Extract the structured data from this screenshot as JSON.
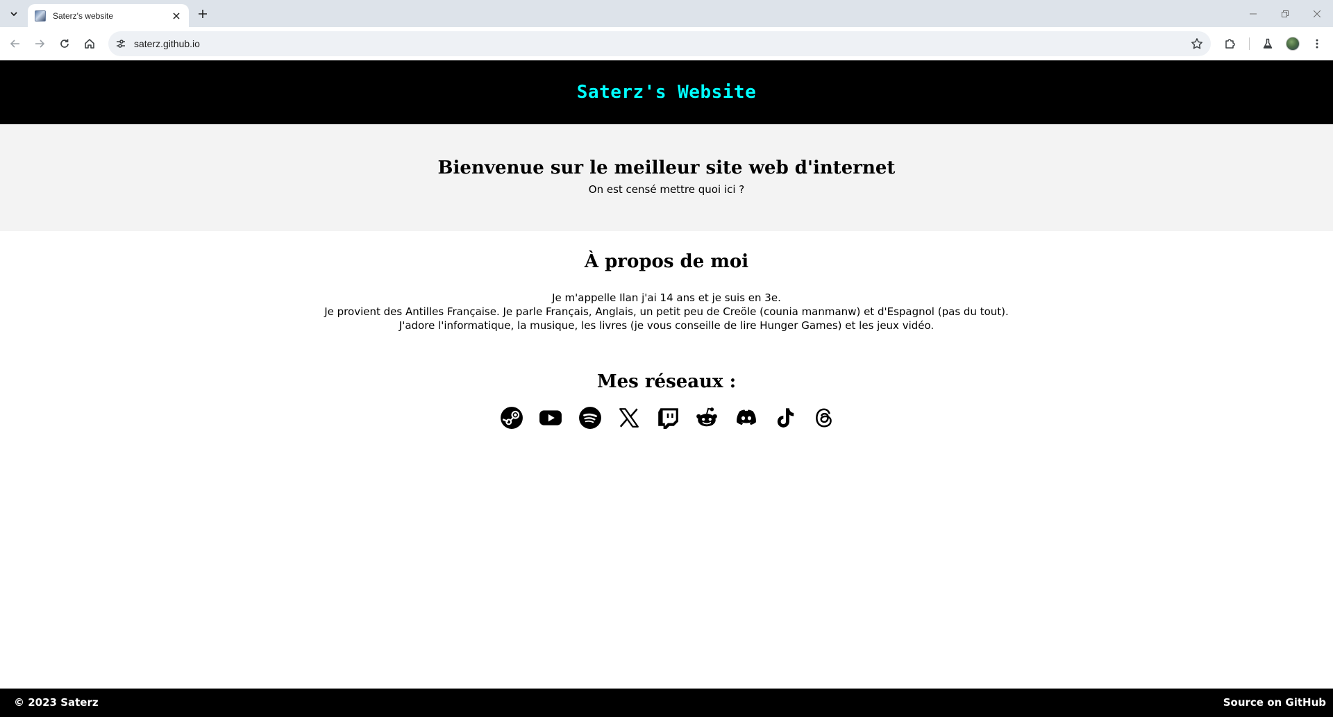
{
  "browser": {
    "tab_title": "Saterz's website",
    "url": "saterz.github.io"
  },
  "icons": {
    "tab_menu": "chevron-down-icon",
    "favicon": "site-favicon",
    "tab_close": "close-icon",
    "new_tab": "plus-icon",
    "back": "arrow-left-icon",
    "forward": "arrow-right-icon",
    "reload": "reload-icon",
    "home": "home-icon",
    "site_info": "tune-icon",
    "bookmark": "star-icon",
    "extensions": "puzzle-icon",
    "labs": "flask-icon",
    "profile": "avatar",
    "menu": "more-vertical-icon",
    "minimize": "minimize-icon",
    "restore": "restore-icon",
    "close_window": "close-icon"
  },
  "site": {
    "header_title": "Saterz's Website",
    "hero": {
      "title": "Bienvenue sur le meilleur site web d'internet",
      "subtitle": "On est censé mettre quoi ici ?"
    },
    "about": {
      "title": "À propos de moi",
      "lines": [
        "Je m'appelle Ilan j'ai 14 ans et je suis en 3e.",
        "Je provient des Antilles Française. Je parle Français, Anglais, un petit peu de Creöle (counia manmanw) et d'Espagnol (pas du tout).",
        "J'adore l'informatique, la musique, les livres (je vous conseille de lire Hunger Games) et les jeux vidéo."
      ]
    },
    "networks": {
      "title": "Mes réseaux :",
      "items": [
        "steam-icon",
        "youtube-icon",
        "spotify-icon",
        "x-icon",
        "twitch-icon",
        "reddit-icon",
        "discord-icon",
        "tiktok-icon",
        "threads-icon"
      ]
    },
    "footer": {
      "copyright": "© 2023 Saterz",
      "source_link": "Source on GitHub"
    },
    "colors": {
      "header_bg": "#000000",
      "title_accent": "#00ffff",
      "hero_bg": "#f3f3f3",
      "footer_bg": "#000000"
    }
  }
}
